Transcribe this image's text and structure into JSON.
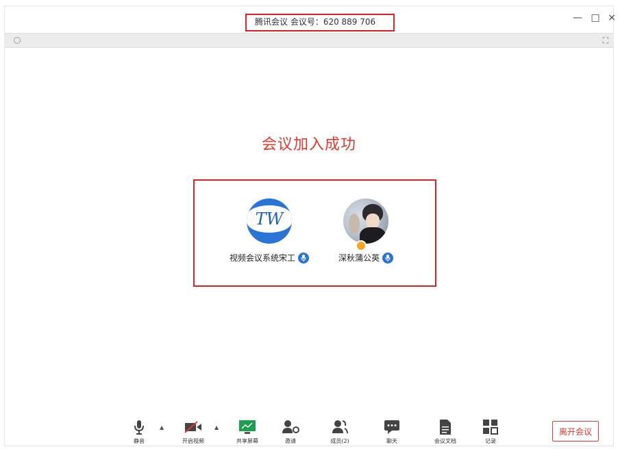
{
  "window": {
    "title": "腾讯会议 会议号：620 889 706",
    "minimize": "—",
    "maximize": "□",
    "close": "×"
  },
  "subbar": {
    "fullscreen_glyph": "⛶"
  },
  "status": {
    "message": "会议加入成功"
  },
  "participants": [
    {
      "name": "视频会议系统宋工",
      "avatar_text": "TW",
      "mic_icon": "microphone-icon"
    },
    {
      "name": "深秋蒲公英",
      "role_badge": "host-badge",
      "mic_icon": "microphone-icon"
    }
  ],
  "toolbar": {
    "mute": "静音",
    "video": "开启视频",
    "share": "共享屏幕",
    "invite": "邀请",
    "members": "成员(2)",
    "chat": "聊天",
    "docs": "会议文档",
    "record": "记录",
    "leave": "离开会议"
  },
  "colors": {
    "accent_red": "#e03a2f",
    "brand_blue": "#2a74d6",
    "share_green": "#1f9e52"
  }
}
